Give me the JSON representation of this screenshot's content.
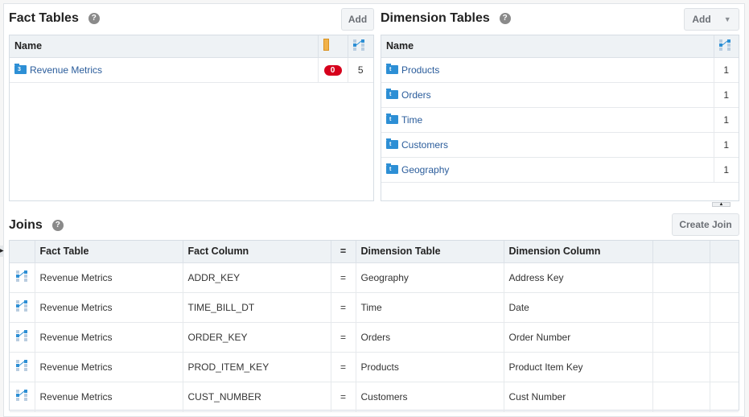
{
  "fact_tables": {
    "title": "Fact Tables",
    "help": "?",
    "add_label": "Add",
    "columns": {
      "name": "Name",
      "measures_icon": "ruler-icon",
      "joins_icon": "join-icon"
    },
    "rows": [
      {
        "name": "Revenue Metrics",
        "icon": "fact-table-icon",
        "icon_glyph": "3",
        "measures_badge": "0",
        "joins": "5"
      }
    ]
  },
  "dimension_tables": {
    "title": "Dimension Tables",
    "help": "?",
    "add_label": "Add",
    "columns": {
      "name": "Name",
      "joins_icon": "join-icon"
    },
    "rows": [
      {
        "name": "Products",
        "joins": "1"
      },
      {
        "name": "Orders",
        "joins": "1"
      },
      {
        "name": "Time",
        "joins": "1"
      },
      {
        "name": "Customers",
        "joins": "1"
      },
      {
        "name": "Geography",
        "joins": "1"
      }
    ],
    "icon_glyph": "t"
  },
  "joins": {
    "title": "Joins",
    "help": "?",
    "create_label": "Create Join",
    "columns": [
      "",
      "Fact Table",
      "Fact Column",
      "=",
      "Dimension Table",
      "Dimension Column",
      "",
      ""
    ],
    "rows": [
      {
        "fact_table": "Revenue Metrics",
        "fact_column": "ADDR_KEY",
        "op": "=",
        "dimension_table": "Geography",
        "dimension_column": "Address Key"
      },
      {
        "fact_table": "Revenue Metrics",
        "fact_column": "TIME_BILL_DT",
        "op": "=",
        "dimension_table": "Time",
        "dimension_column": "Date"
      },
      {
        "fact_table": "Revenue Metrics",
        "fact_column": "ORDER_KEY",
        "op": "=",
        "dimension_table": "Orders",
        "dimension_column": "Order Number"
      },
      {
        "fact_table": "Revenue Metrics",
        "fact_column": "PROD_ITEM_KEY",
        "op": "=",
        "dimension_table": "Products",
        "dimension_column": "Product Item Key"
      },
      {
        "fact_table": "Revenue Metrics",
        "fact_column": "CUST_NUMBER",
        "op": "=",
        "dimension_table": "Customers",
        "dimension_column": "Cust Number"
      }
    ]
  },
  "colors": {
    "link": "#2a5c9b",
    "folder": "#2d8fd5",
    "badge": "#d6001c",
    "ruler": "#f1b24a"
  }
}
